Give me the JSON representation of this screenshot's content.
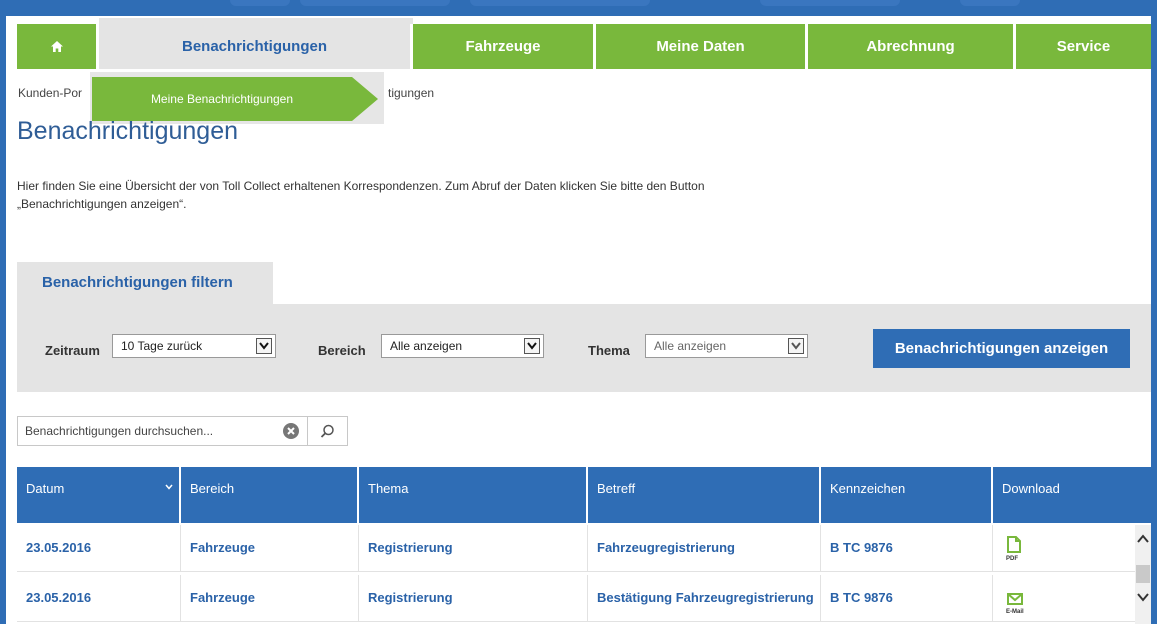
{
  "nav": {
    "home_icon": "home-icon",
    "items": [
      {
        "label": "Benachrichtigungen",
        "active": true
      },
      {
        "label": "Fahrzeuge"
      },
      {
        "label": "Meine Daten"
      },
      {
        "label": "Abrechnung"
      },
      {
        "label": "Service"
      }
    ],
    "dropdown_item": "Meine Benachrichtigungen"
  },
  "breadcrumb": {
    "left": "Kunden-Por",
    "right": "tigungen"
  },
  "page": {
    "title": "Benachrichtigungen",
    "intro": "Hier finden Sie eine Übersicht der von Toll Collect erhaltenen Korrespondenzen. Zum Abruf der Daten klicken Sie bitte den Button „Benachrichtigungen anzeigen“."
  },
  "filter": {
    "tab_label": "Benachrichtigungen filtern",
    "zeitraum_label": "Zeitraum",
    "zeitraum_value": "10 Tage zurück",
    "bereich_label": "Bereich",
    "bereich_value": "Alle anzeigen",
    "thema_label": "Thema",
    "thema_value": "Alle anzeigen",
    "button_label": "Benachrichtigungen anzeigen"
  },
  "search": {
    "placeholder": "Benachrichtigungen durchsuchen..."
  },
  "table": {
    "headers": [
      "Datum",
      "Bereich",
      "Thema",
      "Betreff",
      "Kennzeichen",
      "Download"
    ],
    "rows": [
      {
        "datum": "23.05.2016",
        "bereich": "Fahrzeuge",
        "thema": "Registrierung",
        "betreff": "Fahrzeugregistrierung",
        "kennzeichen": "B TC 9876",
        "download_label": "PDF"
      },
      {
        "datum": "23.05.2016",
        "bereich": "Fahrzeuge",
        "thema": "Registrierung",
        "betreff": "Bestätigung Fahrzeugregistrierung",
        "kennzeichen": "B TC 9876",
        "download_label": "E-Mail"
      }
    ]
  },
  "colors": {
    "green": "#79b83c",
    "blue": "#2f6db5",
    "grey_panel": "#e4e4e4",
    "link_blue": "#2a62a8"
  }
}
